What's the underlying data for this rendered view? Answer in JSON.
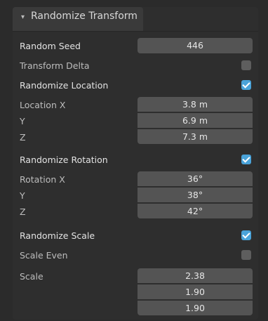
{
  "panel": {
    "title": "Randomize Transform",
    "arrow": "▾"
  },
  "fields": {
    "random_seed": {
      "label": "Random Seed",
      "value": "446"
    },
    "transform_delta": {
      "label": "Transform Delta",
      "checked": false
    },
    "randomize_location": {
      "label": "Randomize Location",
      "checked": true
    },
    "location": {
      "label_x": "Location X",
      "label_y": "Y",
      "label_z": "Z",
      "x": "3.8 m",
      "y": "6.9 m",
      "z": "7.3 m"
    },
    "randomize_rotation": {
      "label": "Randomize Rotation",
      "checked": true
    },
    "rotation": {
      "label_x": "Rotation X",
      "label_y": "Y",
      "label_z": "Z",
      "x": "36°",
      "y": "38°",
      "z": "42°"
    },
    "randomize_scale": {
      "label": "Randomize Scale",
      "checked": true
    },
    "scale_even": {
      "label": "Scale Even",
      "checked": false
    },
    "scale": {
      "label": "Scale",
      "x": "2.38",
      "y": "1.90",
      "z": "1.90"
    }
  },
  "colors": {
    "accent": "#4aa3d9",
    "field_bg": "#545454",
    "panel_bg": "#2e2e2e"
  }
}
